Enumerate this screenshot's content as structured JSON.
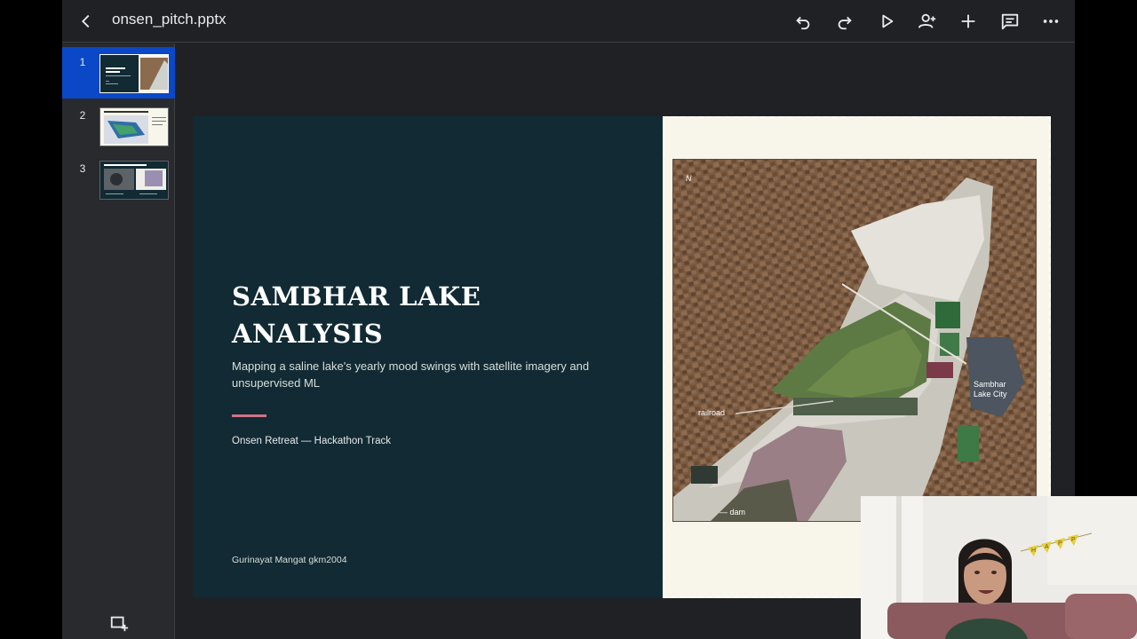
{
  "app": {
    "file_name": "onsen_pitch.pptx"
  },
  "toolbar": {
    "icons": [
      "back-arrow-icon",
      "undo-icon",
      "redo-icon",
      "play-icon",
      "add-person-icon",
      "plus-icon",
      "comment-icon",
      "more-icon"
    ]
  },
  "sidebar": {
    "slides": [
      {
        "number": "1",
        "active": true
      },
      {
        "number": "2",
        "active": false
      },
      {
        "number": "3",
        "active": false
      }
    ],
    "add_slide_icon": "add-slide-icon"
  },
  "slide": {
    "title": "SAMBHAR LAKE ANALYSIS",
    "subtitle": "Mapping a saline lake's yearly mood swings with satellite imagery and unsupervised ML",
    "event": "Onsen Retreat — Hackathon Track",
    "author": "Gurinayat Mangat gkm2004",
    "accent_color": "#d27286",
    "background_color": "#112a33",
    "map_labels": {
      "north": "N",
      "city_line1": "Sambhar",
      "city_line2": "Lake City",
      "railroad": "railroad",
      "dam": "— dam"
    }
  },
  "webcam": {
    "banner_letters": [
      "H",
      "A",
      "P",
      "P",
      "Y"
    ]
  }
}
